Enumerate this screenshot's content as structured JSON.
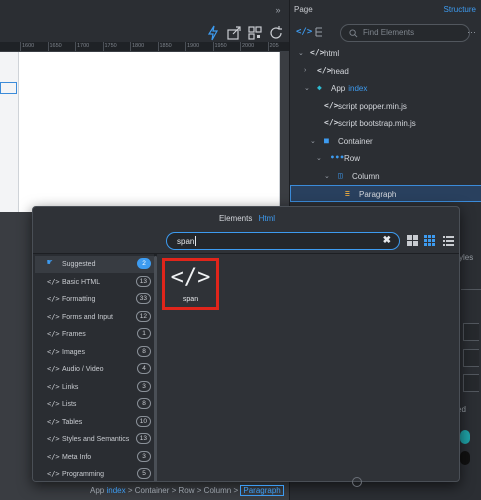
{
  "toolbar": {
    "collapse_icon": "double-chevron-right-icon",
    "icons": [
      "lightning-icon",
      "export-icon",
      "qr-icon",
      "expand-icon",
      "refresh-icon"
    ]
  },
  "ruler": {
    "ticks": [
      "1600",
      "1650",
      "1700",
      "1750",
      "1800",
      "1850",
      "1900",
      "1950",
      "2000",
      "205"
    ]
  },
  "right_panel": {
    "page_label": "Page",
    "structure_label": "Structure",
    "find_placeholder": "Find Elements",
    "more_label": "···",
    "tree": [
      {
        "label": "html",
        "icon": "</>",
        "arrow": "⌄"
      },
      {
        "label": "head",
        "icon": "</>",
        "arrow": "›"
      },
      {
        "label": "App",
        "label_hl": "index",
        "icon": "◆",
        "arrow": "⌄"
      },
      {
        "label": "script popper.min.js",
        "icon": "</>"
      },
      {
        "label": "script bootstrap.min.js",
        "icon": "</>"
      },
      {
        "label": "Container",
        "icon": "■",
        "arrow": "⌄"
      },
      {
        "label": "Row",
        "icon": "•••",
        "arrow": "⌄"
      },
      {
        "label": "Column",
        "icon": "◫",
        "arrow": "⌄"
      },
      {
        "label": "Paragraph",
        "icon": "≡"
      }
    ],
    "styles_label": "yles",
    "check_label": "ed"
  },
  "dialog": {
    "title": "Elements",
    "subtitle": "Html",
    "search_value": "span",
    "clear_label": "✖",
    "categories": [
      {
        "label": "Suggested",
        "count": "2",
        "icon": "☛"
      },
      {
        "label": "Basic HTML",
        "count": "13",
        "icon": "</>"
      },
      {
        "label": "Formatting",
        "count": "33",
        "icon": "</>"
      },
      {
        "label": "Forms and Input",
        "count": "12",
        "icon": "</>"
      },
      {
        "label": "Frames",
        "count": "1",
        "icon": "</>"
      },
      {
        "label": "Images",
        "count": "8",
        "icon": "</>"
      },
      {
        "label": "Audio / Video",
        "count": "4",
        "icon": "</>"
      },
      {
        "label": "Links",
        "count": "3",
        "icon": "</>"
      },
      {
        "label": "Lists",
        "count": "8",
        "icon": "</>"
      },
      {
        "label": "Tables",
        "count": "10",
        "icon": "</>"
      },
      {
        "label": "Styles and Semantics",
        "count": "13",
        "icon": "</>"
      },
      {
        "label": "Meta Info",
        "count": "3",
        "icon": "</>"
      },
      {
        "label": "Programming",
        "count": "5",
        "icon": "</>"
      }
    ],
    "result": {
      "label": "span",
      "icon": "</>"
    }
  },
  "breadcrumb": {
    "app": "App",
    "index": "index",
    "sep": " > ",
    "items": [
      "Container",
      "Row",
      "Column"
    ],
    "selected": "Paragraph"
  },
  "colors": {
    "accent": "#3d9bf0",
    "highlight_border": "#e0251b",
    "selected_row": "#29405e"
  }
}
